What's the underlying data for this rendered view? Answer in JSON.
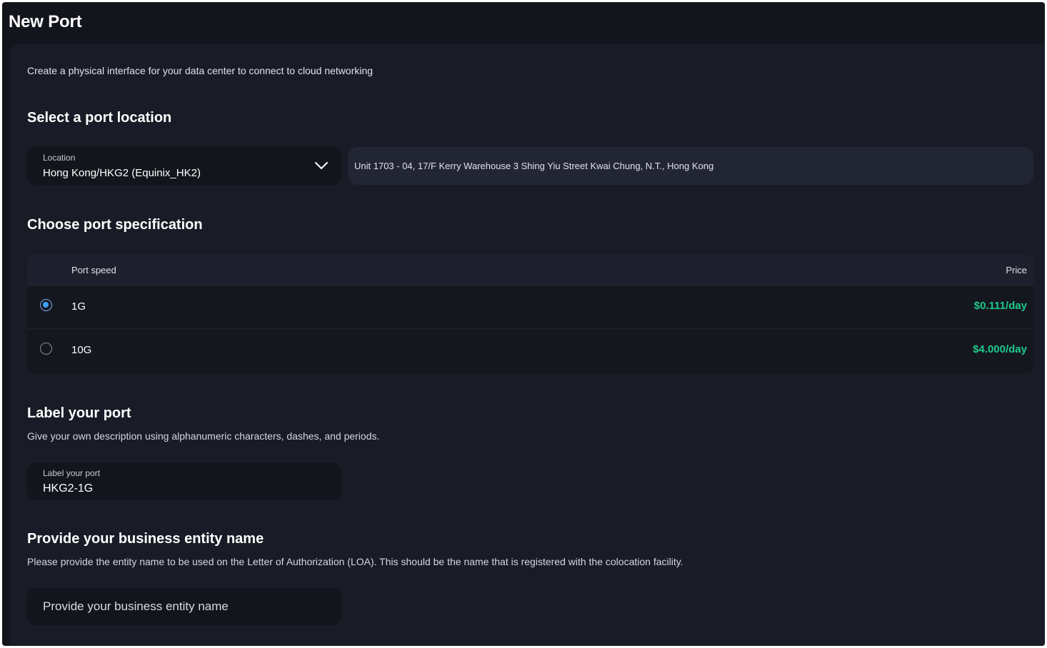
{
  "page": {
    "title": "New Port"
  },
  "intro": "Create a physical interface for your data center to connect to cloud networking",
  "location": {
    "heading": "Select a port location",
    "field_label": "Location",
    "selected": "Hong Kong/HKG2 (Equinix_HK2)",
    "address": "Unit 1703 - 04, 17/F Kerry Warehouse 3 Shing Yiu Street Kwai Chung, N.T., Hong Kong"
  },
  "spec": {
    "heading": "Choose port specification",
    "columns": {
      "speed": "Port speed",
      "price": "Price"
    },
    "rows": [
      {
        "speed": "1G",
        "price": "$0.111/day",
        "selected": true
      },
      {
        "speed": "10G",
        "price": "$4.000/day",
        "selected": false
      }
    ]
  },
  "label": {
    "heading": "Label your port",
    "description": "Give your own description using alphanumeric characters, dashes, and periods.",
    "field_label": "Label your port",
    "value": "HKG2-1G"
  },
  "entity": {
    "heading": "Provide your business entity name",
    "description": "Please provide the entity name to be used on the Letter of Authorization (LOA). This should be the name that is registered with the colocation facility.",
    "placeholder": "Provide your business entity name"
  },
  "colors": {
    "background": "#13151c",
    "panel": "#191c26",
    "price_green": "#1ec98a",
    "radio_blue": "#3ea0ff"
  },
  "icons": {
    "dropdown": "chevron-down-icon"
  }
}
